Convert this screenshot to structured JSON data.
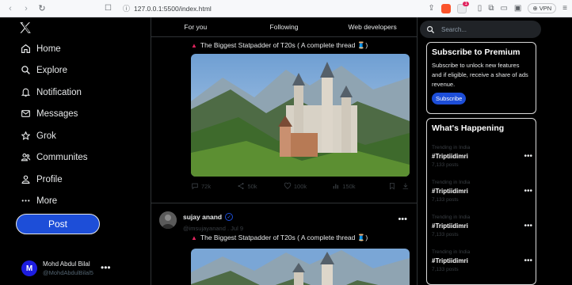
{
  "browser": {
    "url": "127.0.0.1:5500/index.html",
    "notification_count": "1",
    "vpn_label": "VPN"
  },
  "sidebar": {
    "logo": "x-logo-icon",
    "items": [
      {
        "label": "Home",
        "icon": "home-icon"
      },
      {
        "label": "Explore",
        "icon": "search-icon"
      },
      {
        "label": "Notification",
        "icon": "bell-icon"
      },
      {
        "label": "Messages",
        "icon": "mail-icon"
      },
      {
        "label": "Grok",
        "icon": "star-icon"
      },
      {
        "label": "Communites",
        "icon": "people-icon"
      },
      {
        "label": "Profile",
        "icon": "person-icon"
      },
      {
        "label": "More",
        "icon": "more-dots-icon"
      }
    ],
    "post_label": "Post",
    "user": {
      "avatar_letter": "M",
      "name": "Mohd Abdul Bilal",
      "handle": "@MohdAbdulBilal5",
      "menu": "•••"
    }
  },
  "main": {
    "tabs": [
      "For you",
      "Following",
      "Web developers"
    ],
    "posts": [
      {
        "title": "The Biggest Statpadder of T20s ( A complete thread 🧵)",
        "stats": {
          "replies": "72k",
          "reposts": "50k",
          "likes": "100k",
          "views": "150k"
        }
      },
      {
        "author": "sujay anand",
        "handle": "@imsujayanand . Jul 9",
        "menu": "•••",
        "title": "The Biggest Statpadder of T20s ( A complete thread 🧵)"
      }
    ]
  },
  "right": {
    "search_placeholder": "Search...",
    "premium": {
      "title": "Subscribe to Premium",
      "text": "Subscribe to unlock new features and if eligible, receive a share of ads revenue.",
      "button": "Subscribe"
    },
    "happening": {
      "title": "What's Happening",
      "trends": [
        {
          "label": "Trending in India",
          "tag": "#Triptiidimri",
          "count": "7,133 posts"
        },
        {
          "label": "Trending in India",
          "tag": "#Triptiidimri",
          "count": "7,133 posts"
        },
        {
          "label": "Trending in India",
          "tag": "#Triptiidimri",
          "count": "7,133 posts"
        },
        {
          "label": "Trending in India",
          "tag": "#Triptiidimri",
          "count": "7,133 posts"
        }
      ],
      "menu": "•••"
    }
  },
  "colors": {
    "accent": "#1d4ed8",
    "background": "#000000",
    "border": "#2f3336",
    "muted": "#3a3f44"
  }
}
